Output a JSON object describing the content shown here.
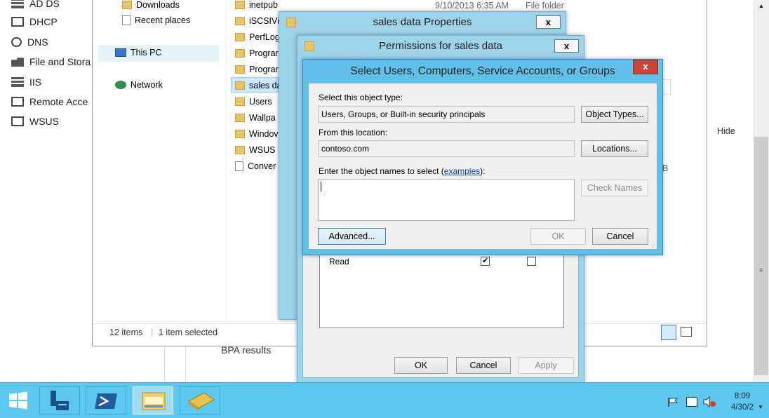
{
  "server_manager": {
    "nav": [
      {
        "label": "AD DS",
        "icon": "ad-ds-icon"
      },
      {
        "label": "DHCP",
        "icon": "dhcp-icon"
      },
      {
        "label": "DNS",
        "icon": "dns-icon"
      },
      {
        "label": "File and Stora",
        "icon": "file-storage-icon"
      },
      {
        "label": "IIS",
        "icon": "iis-icon"
      },
      {
        "label": "Remote Acce",
        "icon": "remote-access-icon"
      },
      {
        "label": "WSUS",
        "icon": "wsus-icon"
      }
    ],
    "bpa_results": "BPA results",
    "hide": "Hide",
    "partial_b": "B"
  },
  "explorer": {
    "nav": {
      "downloads": "Downloads",
      "recent_places": "Recent places",
      "this_pc": "This PC",
      "network": "Network"
    },
    "files": [
      {
        "name": "inetpub",
        "type": "folder"
      },
      {
        "name": "iSCSIVi",
        "type": "folder"
      },
      {
        "name": "PerfLog",
        "type": "folder"
      },
      {
        "name": "Prograr",
        "type": "folder"
      },
      {
        "name": "Prograr",
        "type": "folder"
      },
      {
        "name": "sales da",
        "type": "folder"
      },
      {
        "name": "Users",
        "type": "folder"
      },
      {
        "name": "Wallpa",
        "type": "folder"
      },
      {
        "name": "Windov",
        "type": "folder"
      },
      {
        "name": "WSUS",
        "type": "folder"
      },
      {
        "name": "Conver",
        "type": "file"
      }
    ],
    "first_row_date": "9/10/2013 6:35 AM",
    "first_row_type": "File folder",
    "status_items": "12 items",
    "status_selected": "1 item selected"
  },
  "properties_dialog": {
    "title": "sales data Properties"
  },
  "permissions_dialog": {
    "title": "Permissions for sales data",
    "perm_row": {
      "label": "Read",
      "allow": true,
      "deny": false
    },
    "ok": "OK",
    "cancel": "Cancel",
    "apply": "Apply"
  },
  "select_dialog": {
    "title": "Select Users, Computers, Service Accounts, or Groups",
    "object_type_label": "Select this object type:",
    "object_type_value": "Users, Groups, or Built-in security principals",
    "object_types_button": "Object Types...",
    "location_label": "From this location:",
    "location_value": "contoso.com",
    "locations_button": "Locations...",
    "enter_label_prefix": "Enter the object names to select (",
    "examples_link": "examples",
    "enter_label_suffix": "):",
    "names_value": "",
    "check_names_button": "Check Names",
    "advanced_button": "Advanced...",
    "ok_button": "OK",
    "cancel_button": "Cancel",
    "close_glyph": "x"
  },
  "taskbar": {
    "clock_time": "8:09",
    "clock_date": "4/30/2"
  }
}
